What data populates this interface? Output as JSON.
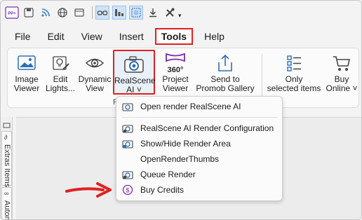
{
  "quick_access": {
    "app_badge": "PP+",
    "icons": [
      "app-logo-icon",
      "save-icon",
      "rss-icon",
      "globe-icon",
      "folder-icon",
      "glasses-icon",
      "chart-icon",
      "grid-icon",
      "download-icon",
      "tools-icon"
    ]
  },
  "menubar": {
    "items": [
      "File",
      "Edit",
      "View",
      "Insert",
      "Tools",
      "Help"
    ],
    "active": "Tools"
  },
  "ribbon": {
    "image_viewer": "Image\nViewer",
    "edit_lights": "Edit\nLights...",
    "dynamic_view": "Dynamic\nView",
    "realscene_ai": "RealScene\nAI ˅",
    "project_viewer": "Project\nViewer",
    "project_viewer_badge": "360°",
    "send_to_gallery": "Send to\nPromob Gallery",
    "only_selected": "Only\nselected items",
    "buy_online": "Buy\nOnline ˅",
    "group_label_partial": "P"
  },
  "left_pane": {
    "tab1": "Extras Items",
    "tab2": "Autom"
  },
  "dropdown": {
    "items": [
      {
        "label": "Open render RealScene AI",
        "icon": "camera-icon"
      },
      {
        "label": "RealScene AI Render Configuration",
        "icon": "camera-gear-icon"
      },
      {
        "label": "Show/Hide Render Area",
        "icon": "camera-area-icon"
      },
      {
        "label": "OpenRenderThumbs",
        "icon": ""
      },
      {
        "label": "Queue Render",
        "icon": "camera-queue-icon"
      },
      {
        "label": "Buy Credits",
        "icon": "dollar-coin-icon"
      }
    ]
  },
  "colors": {
    "highlight_red": "#e02020",
    "ribbon_bg": "#fbfbfb",
    "icon_blue": "#2f6fb3"
  }
}
